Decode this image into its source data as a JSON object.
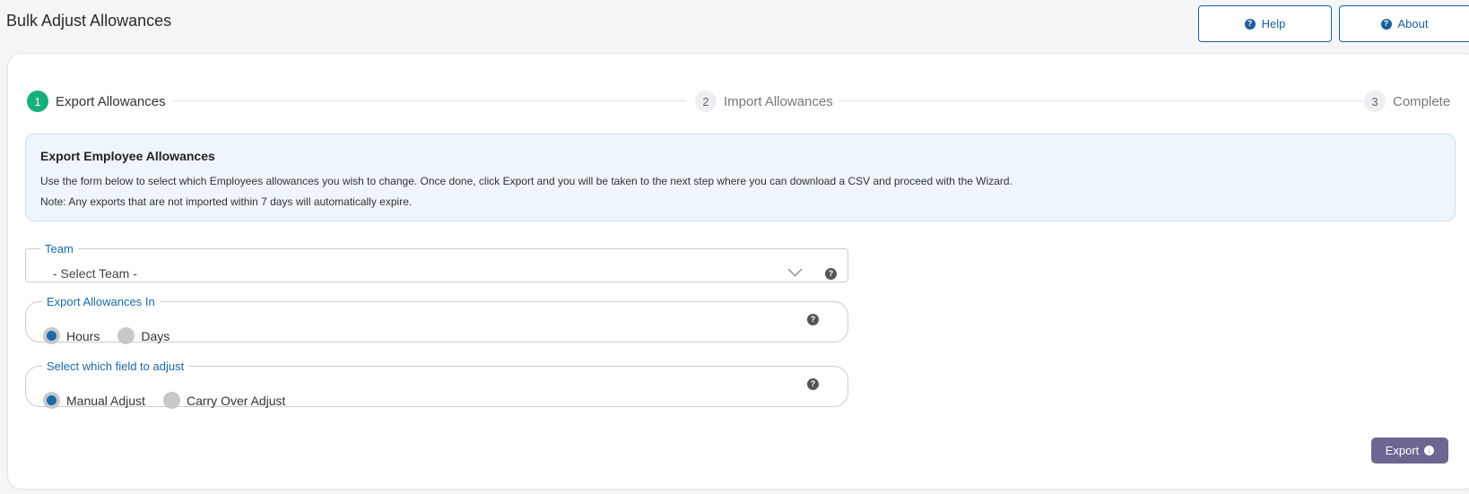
{
  "header": {
    "title": "Bulk Adjust Allowances",
    "help_label": "Help",
    "about_label": "About"
  },
  "stepper": {
    "steps": [
      {
        "number": "1",
        "label": "Export Allowances",
        "state": "active"
      },
      {
        "number": "2",
        "label": "Import Allowances",
        "state": "inactive"
      },
      {
        "number": "3",
        "label": "Complete",
        "state": "inactive"
      }
    ]
  },
  "info": {
    "title": "Export Employee Allowances",
    "line1": "Use the form below to select which Employees allowances you wish to change. Once done, click Export and you will be taken to the next step where you can download a CSV and proceed with the Wizard.",
    "line2": "Note: Any exports that are not imported within 7 days will automatically expire."
  },
  "team": {
    "label": "Team",
    "value": "- Select Team -"
  },
  "units": {
    "label": "Export Allowances In",
    "options": [
      "Hours",
      "Days"
    ],
    "selected": "Hours"
  },
  "adjust_field": {
    "label": "Select which field to adjust",
    "options": [
      "Manual Adjust",
      "Carry Over Adjust"
    ],
    "selected": "Manual Adjust"
  },
  "actions": {
    "export_label": "Export"
  },
  "colors": {
    "accent": "#1a6aa8",
    "step_active": "#17b07b",
    "export_button": "#6b6790"
  }
}
